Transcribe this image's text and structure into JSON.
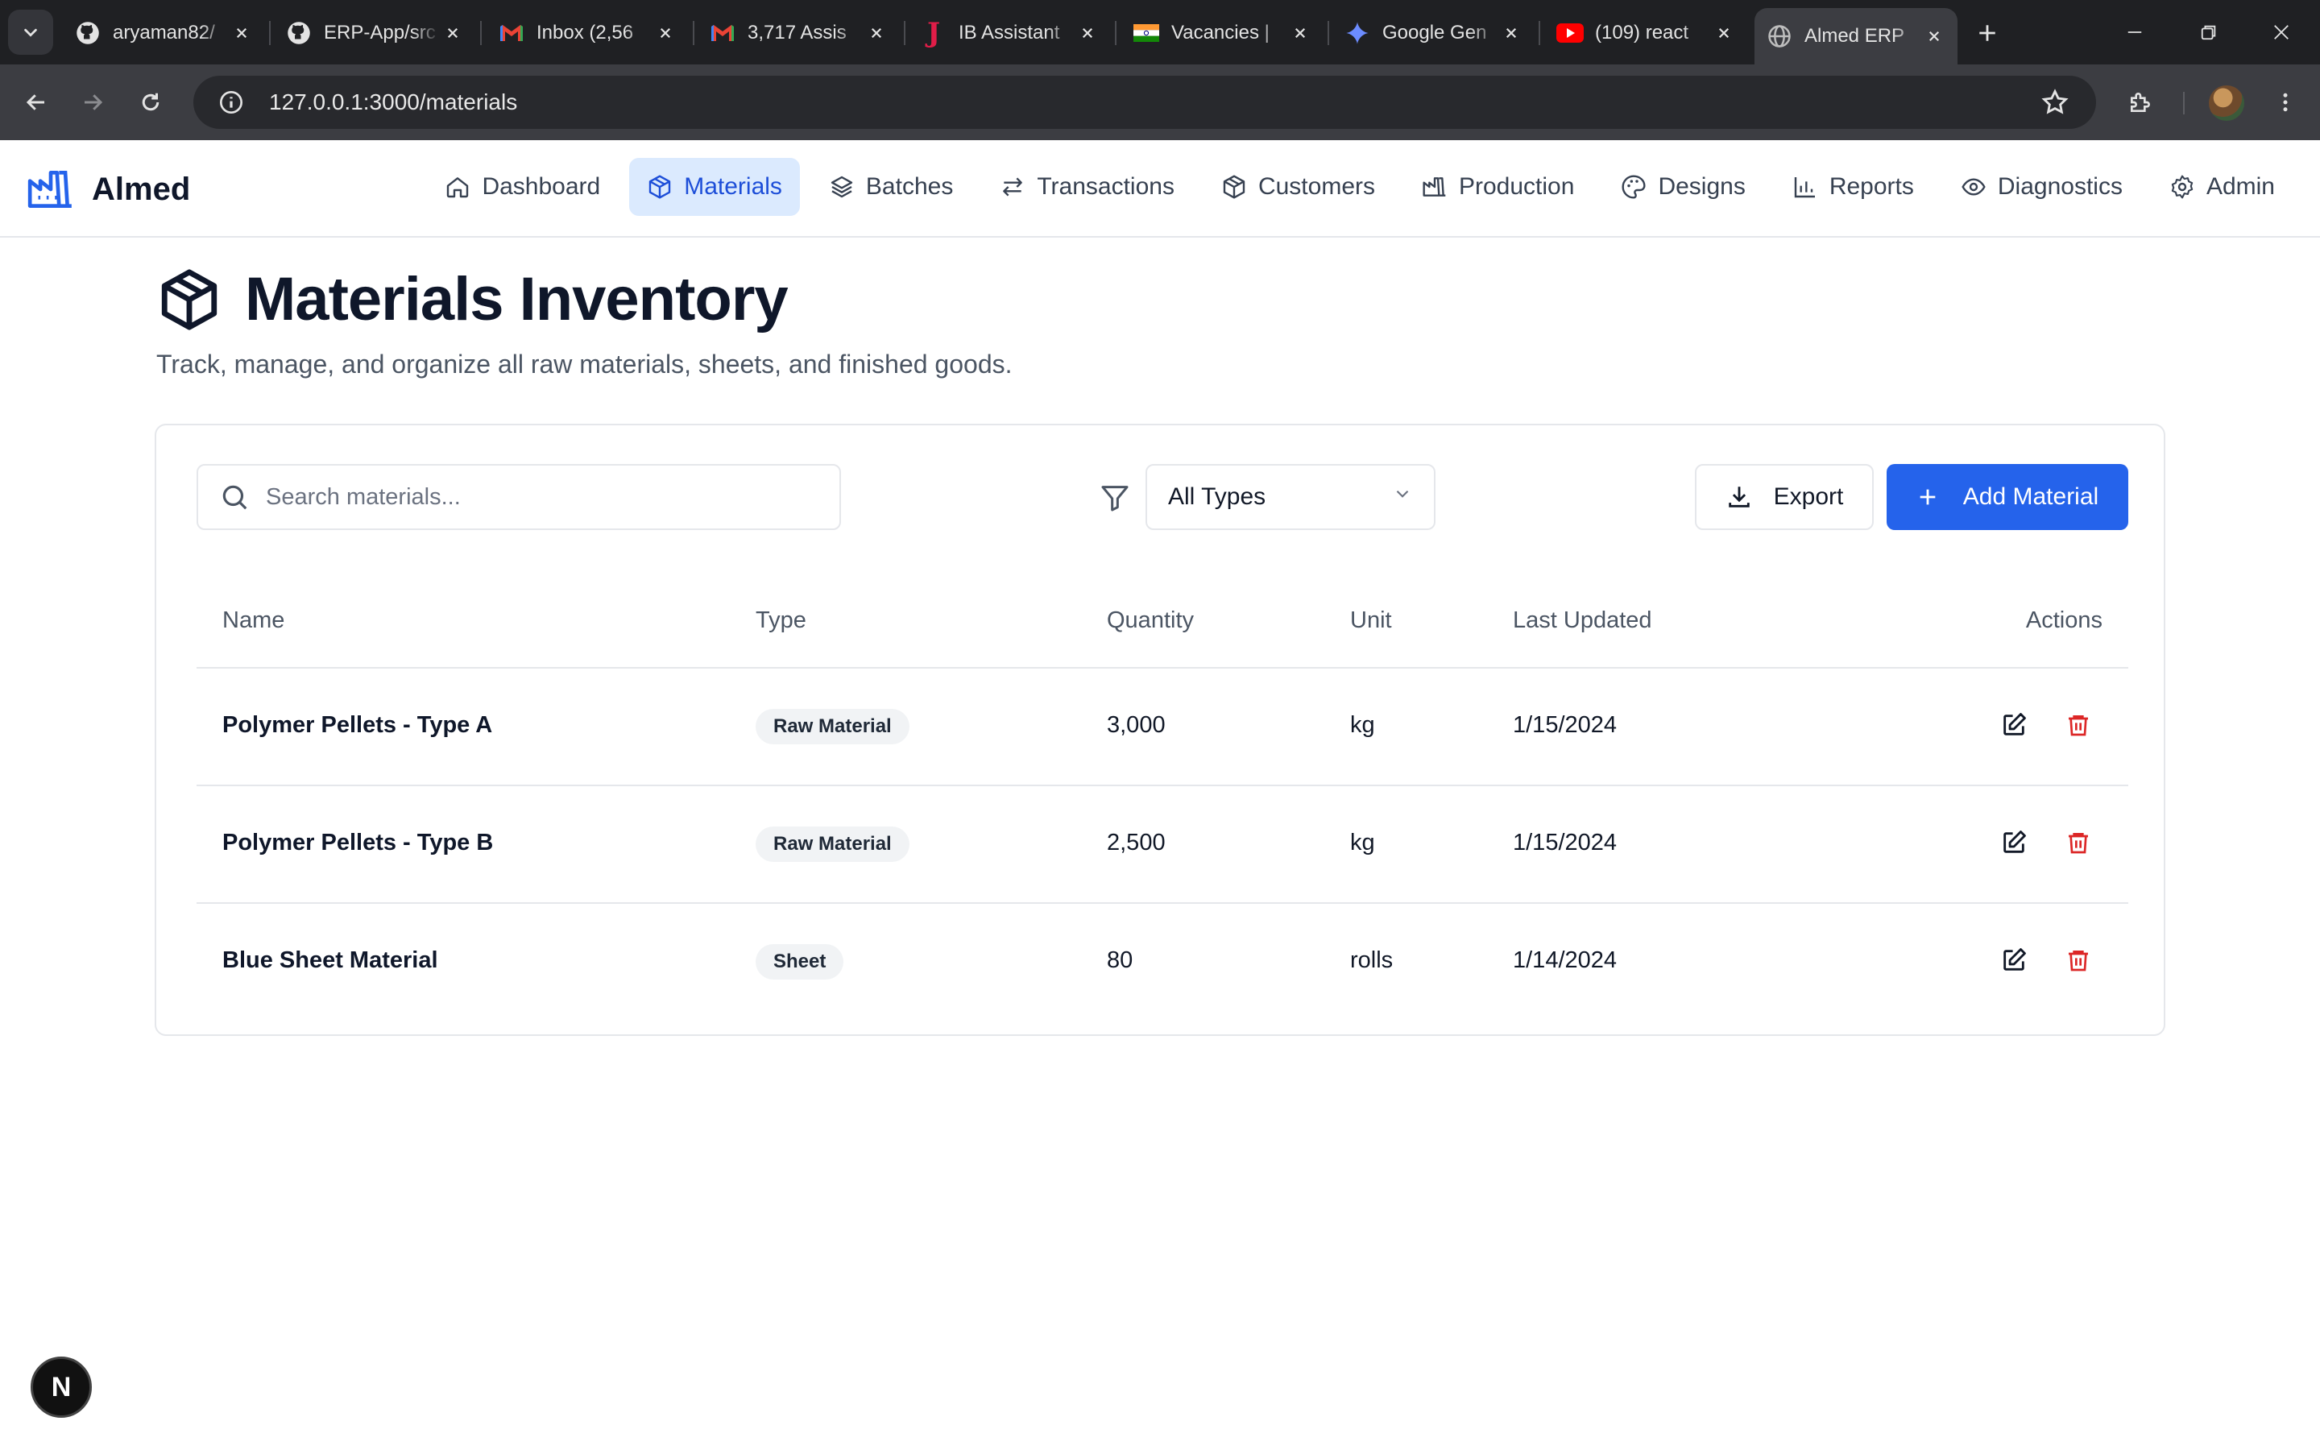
{
  "browser": {
    "tabs": [
      {
        "title": "aryaman82/",
        "favicon": "github-icon"
      },
      {
        "title": "ERP-App/src",
        "favicon": "github-icon"
      },
      {
        "title": "Inbox (2,56",
        "favicon": "gmail-icon"
      },
      {
        "title": "3,717 Assis",
        "favicon": "gmail-icon"
      },
      {
        "title": "IB Assistant",
        "favicon": "j-icon"
      },
      {
        "title": "Vacancies |",
        "favicon": "india-flag-icon"
      },
      {
        "title": "Google Gen",
        "favicon": "gemini-icon"
      },
      {
        "title": "(109) react",
        "favicon": "youtube-icon"
      },
      {
        "title": "Almed ERP",
        "favicon": "globe-icon",
        "active": true
      }
    ],
    "url": "127.0.0.1:3000/materials"
  },
  "app": {
    "brand": "Almed",
    "nav": [
      {
        "label": "Dashboard",
        "icon": "home-icon"
      },
      {
        "label": "Materials",
        "icon": "package-icon",
        "active": true
      },
      {
        "label": "Batches",
        "icon": "layers-icon"
      },
      {
        "label": "Transactions",
        "icon": "arrows-swap-icon"
      },
      {
        "label": "Customers",
        "icon": "package-icon"
      },
      {
        "label": "Production",
        "icon": "factory-icon"
      },
      {
        "label": "Designs",
        "icon": "palette-icon"
      },
      {
        "label": "Reports",
        "icon": "bar-chart-icon"
      },
      {
        "label": "Diagnostics",
        "icon": "eye-icon"
      },
      {
        "label": "Admin",
        "icon": "gear-icon"
      }
    ],
    "accent": "#2563eb"
  },
  "page": {
    "title": "Materials Inventory",
    "subtitle": "Track, manage, and organize all raw materials, sheets, and finished goods."
  },
  "controls": {
    "search_placeholder": "Search materials...",
    "type_filter": "All Types",
    "export_label": "Export",
    "add_label": "Add Material"
  },
  "table": {
    "headers": {
      "name": "Name",
      "type": "Type",
      "quantity": "Quantity",
      "unit": "Unit",
      "last_updated": "Last Updated",
      "actions": "Actions"
    },
    "rows": [
      {
        "name": "Polymer Pellets - Type A",
        "type": "Raw Material",
        "quantity": "3,000",
        "unit": "kg",
        "last_updated": "1/15/2024"
      },
      {
        "name": "Polymer Pellets - Type B",
        "type": "Raw Material",
        "quantity": "2,500",
        "unit": "kg",
        "last_updated": "1/15/2024"
      },
      {
        "name": "Blue Sheet Material",
        "type": "Sheet",
        "quantity": "80",
        "unit": "rolls",
        "last_updated": "1/14/2024"
      }
    ]
  },
  "dev_badge": "N"
}
